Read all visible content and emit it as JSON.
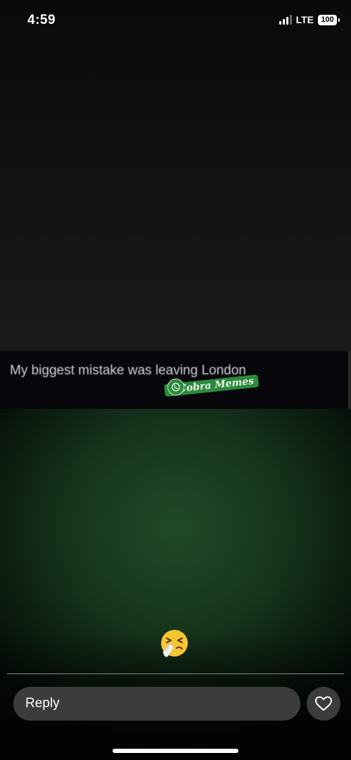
{
  "status_bar": {
    "time": "4:59",
    "network": "LTE",
    "battery": "100"
  },
  "story": {
    "caption": "My biggest mistake was leaving London",
    "watermark": "@Cobra Memes",
    "reaction_icon": "sneezing-face-emoji"
  },
  "reply_bar": {
    "placeholder": "Reply",
    "like_icon": "heart-icon"
  },
  "colors": {
    "banner_bg": "#07070c",
    "watermark_green": "#2c8a3c",
    "input_bg": "#3b3c3b"
  }
}
